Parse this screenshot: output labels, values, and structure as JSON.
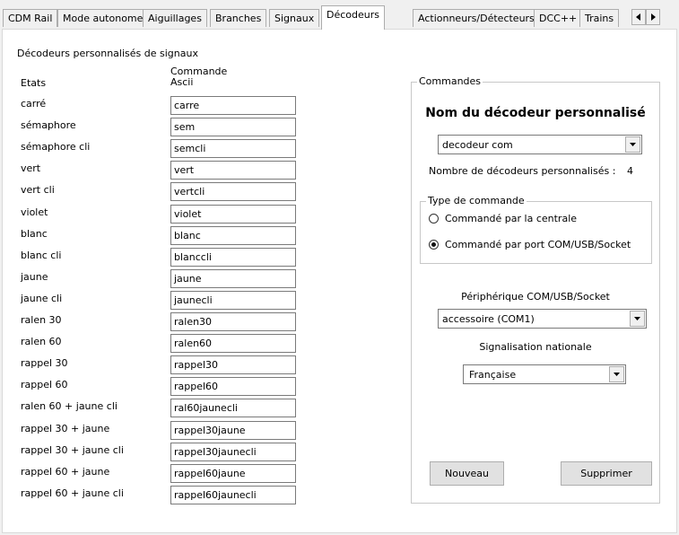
{
  "tabs": [
    {
      "label": "CDM Rail"
    },
    {
      "label": "Mode autonome"
    },
    {
      "label": "Aiguillages"
    },
    {
      "label": "Branches"
    },
    {
      "label": "Signaux"
    },
    {
      "label": "Décodeurs"
    },
    {
      "label": "Actionneurs/Détecteurs"
    },
    {
      "label": "DCC++"
    },
    {
      "label": "Trains"
    }
  ],
  "active_tab": "Décodeurs",
  "scroll_left_icon": "arrow-left-icon",
  "scroll_right_icon": "arrow-right-icon",
  "section_title": "Décodeurs personnalisés de signaux",
  "col_states_header": "Etats",
  "col_command_header_line1": "Commande",
  "col_command_header_line2": "Ascii",
  "rows": [
    {
      "state": "carré",
      "command": "carre"
    },
    {
      "state": "sémaphore",
      "command": "sem"
    },
    {
      "state": "sémaphore cli",
      "command": "semcli"
    },
    {
      "state": "vert",
      "command": "vert"
    },
    {
      "state": "vert cli",
      "command": "vertcli"
    },
    {
      "state": "violet",
      "command": "violet"
    },
    {
      "state": "blanc",
      "command": "blanc"
    },
    {
      "state": "blanc cli",
      "command": "blanccli"
    },
    {
      "state": "jaune",
      "command": "jaune"
    },
    {
      "state": "jaune cli",
      "command": "jaunecli"
    },
    {
      "state": "ralen 30",
      "command": "ralen30"
    },
    {
      "state": "ralen 60",
      "command": "ralen60"
    },
    {
      "state": "rappel 30",
      "command": "rappel30"
    },
    {
      "state": "rappel 60",
      "command": "rappel60"
    },
    {
      "state": "ralen 60 + jaune cli",
      "command": "ral60jaunecli"
    },
    {
      "state": "rappel 30 + jaune",
      "command": "rappel30jaune"
    },
    {
      "state": "rappel 30 + jaune cli",
      "command": "rappel30jaunecli"
    },
    {
      "state": "rappel 60 + jaune",
      "command": "rappel60jaune"
    },
    {
      "state": "rappel 60 + jaune cli",
      "command": "rappel60jaunecli"
    }
  ],
  "commandes": {
    "group_label": "Commandes",
    "decoder_name_title": "Nom du décodeur personnalisé",
    "decoder_select": "decodeur com",
    "count_label": "Nombre de décodeurs personnalisés :",
    "count_value": "4",
    "type_group_label": "Type de commande",
    "radio_centrale": "Commandé par la centrale",
    "radio_port": "Commandé par port COM/USB/Socket",
    "selected_radio": "port",
    "peripheral_label": "Périphérique COM/USB/Socket",
    "peripheral_select": "accessoire (COM1)",
    "signalisation_label": "Signalisation nationale",
    "signalisation_select": "Française",
    "new_button": "Nouveau",
    "delete_button": "Supprimer"
  }
}
